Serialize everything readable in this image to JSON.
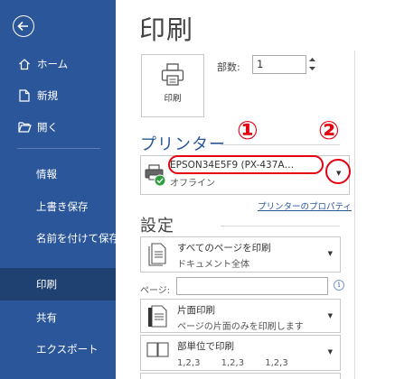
{
  "sidebar": {
    "items": [
      {
        "label": "ホーム",
        "icon": "home-icon"
      },
      {
        "label": "新規",
        "icon": "new-document-icon"
      },
      {
        "label": "開く",
        "icon": "open-folder-icon"
      },
      {
        "label": "情報"
      },
      {
        "label": "上書き保存"
      },
      {
        "label": "名前を付けて保存"
      },
      {
        "label": "印刷",
        "selected": true
      },
      {
        "label": "共有"
      },
      {
        "label": "エクスポート"
      }
    ],
    "bg_color": "#2b579a",
    "selected_color": "#1e4172"
  },
  "main": {
    "title": "印刷",
    "print_button_label": "印刷",
    "copies_label": "部数:",
    "copies_value": "1",
    "printer_section_title": "プリンター",
    "printer": {
      "name": "EPSON34E5F9 (PX-437A…",
      "status": "オフライン"
    },
    "printer_properties_link": "プリンターのプロパティ",
    "settings_section_title": "設定",
    "settings": {
      "range": {
        "main": "すべてのページを印刷",
        "sub": "ドキュメント全体"
      },
      "pages_label": "ページ:",
      "pages_value": "",
      "sides": {
        "main": "片面印刷",
        "sub": "ページの片面のみを印刷します"
      },
      "collate": {
        "main": "部単位で印刷",
        "sub": "1,2,3　　 1,2,3　　 1,2,3"
      }
    }
  },
  "annotations": {
    "marker_1": "①",
    "marker_2": "②",
    "color": "#e60012"
  }
}
